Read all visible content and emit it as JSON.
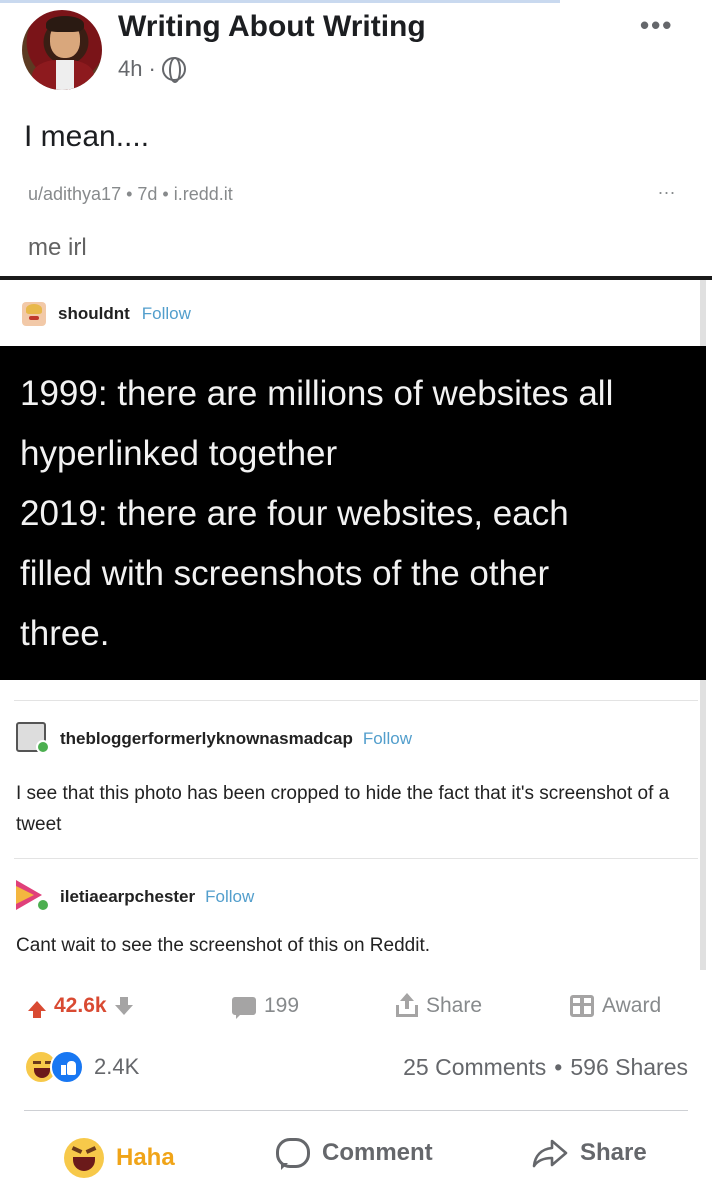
{
  "post": {
    "page_name": "Writing About Writing",
    "time": "4h",
    "dot": "·",
    "caption": "I mean...."
  },
  "reddit": {
    "meta": "u/adithya17 • 7d • i.redd.it",
    "more": "...",
    "title": "me irl",
    "tumblr": {
      "user1": "shouldnt",
      "follow": "Follow",
      "tweet_lines": [
        "1999: there are millions of websites all",
        "hyperlinked together",
        "2019: there are four websites, each",
        "filled with screenshots of the other",
        "three."
      ],
      "user2": "thebloggerformerlyknownasmadcap",
      "reply2": "I see that this photo has been cropped to hide the fact that it's screenshot of a tweet",
      "user3": "iletiaearpchester",
      "reply3": "Cant wait to see the screenshot of this on Reddit."
    },
    "actions": {
      "votes": "42.6k",
      "comments": "199",
      "share": "Share",
      "award": "Award"
    }
  },
  "reactions": {
    "count": "2.4K",
    "comments": "25 Comments",
    "sep": "•",
    "shares": "596 Shares"
  },
  "fb_actions": {
    "haha": "Haha",
    "comment": "Comment",
    "share": "Share"
  },
  "colors": {
    "facebook_blue": "#1877f2",
    "reddit_upvote": "#d94a32",
    "tumblr_follow": "#529ecc",
    "haha_yellow": "#f0a418"
  }
}
